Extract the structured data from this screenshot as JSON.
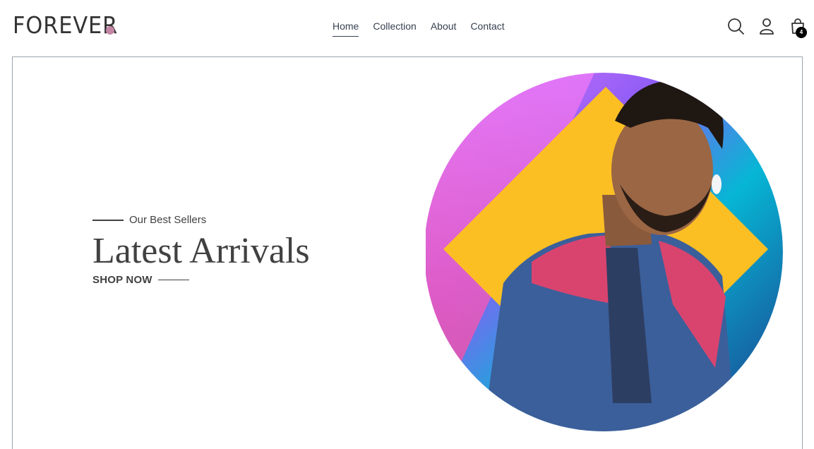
{
  "brand": {
    "name": "FOREVER",
    "dot_color": "#c586a5"
  },
  "nav": {
    "items": [
      {
        "label": "Home",
        "active": true
      },
      {
        "label": "Collection",
        "active": false
      },
      {
        "label": "About",
        "active": false
      },
      {
        "label": "Contact",
        "active": false
      }
    ]
  },
  "header_icons": {
    "search": "search-icon",
    "profile": "profile-icon",
    "cart": "cart-icon",
    "cart_count": "4"
  },
  "hero": {
    "eyebrow": "Our Best Sellers",
    "title": "Latest Arrivals",
    "cta": "SHOP NOW",
    "image": {
      "subject": "man-in-jacket-photo",
      "gradient_colors": [
        "#f472b6",
        "#8b5cf6",
        "#06b6d4",
        "#1e3a8a"
      ],
      "diamond_color": "#fbbf24"
    }
  }
}
